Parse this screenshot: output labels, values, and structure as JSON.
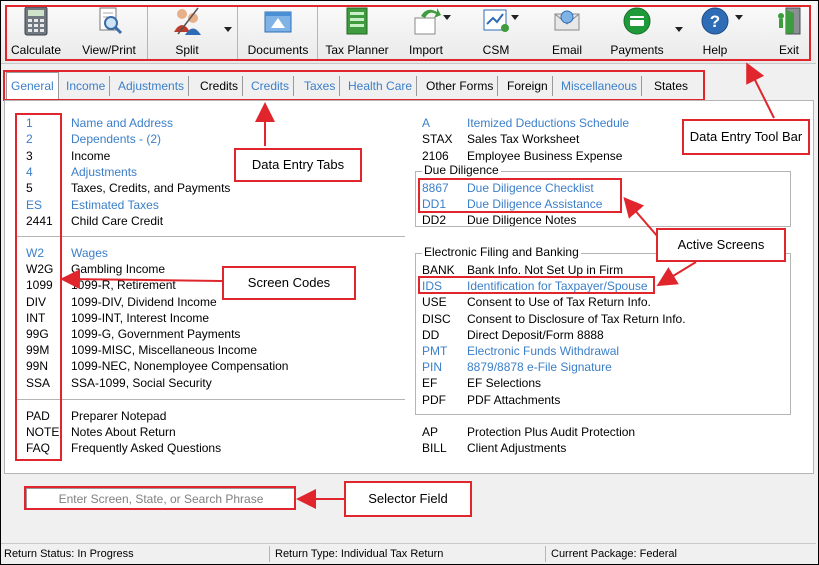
{
  "toolbar": {
    "buttons": [
      {
        "label": "Calculate",
        "icon": "calculator-icon"
      },
      {
        "label": "View/Print",
        "icon": "magnifier-document-icon"
      },
      {
        "label": "Split",
        "icon": "split-people-icon"
      },
      {
        "label": "Documents",
        "icon": "documents-icon"
      },
      {
        "label": "Tax Planner",
        "icon": "tax-planner-icon"
      },
      {
        "label": "Import",
        "icon": "import-icon"
      },
      {
        "label": "CSM",
        "icon": "csm-icon"
      },
      {
        "label": "Email",
        "icon": "email-icon"
      },
      {
        "label": "Payments",
        "icon": "payments-icon"
      },
      {
        "label": "Help",
        "icon": "help-icon"
      },
      {
        "label": "Exit",
        "icon": "exit-door-icon"
      }
    ]
  },
  "tabs": [
    {
      "label": "General",
      "blue": true
    },
    {
      "label": "Income",
      "blue": true
    },
    {
      "label": "Adjustments",
      "blue": true
    },
    {
      "label": "Credits",
      "blue": false
    },
    {
      "label": "Credits",
      "blue": true
    },
    {
      "label": "Taxes",
      "blue": true
    },
    {
      "label": "Health Care",
      "blue": true
    },
    {
      "label": "Other Forms",
      "blue": false
    },
    {
      "label": "Foreign",
      "blue": false
    },
    {
      "label": "Miscellaneous",
      "blue": true
    },
    {
      "label": "States",
      "blue": false
    }
  ],
  "left": {
    "group1": [
      {
        "code": "1",
        "desc": "Name and Address",
        "blue": true
      },
      {
        "code": "2",
        "desc": "Dependents - (2)",
        "blue": true
      },
      {
        "code": "3",
        "desc": "Income",
        "blue": false
      },
      {
        "code": "4",
        "desc": "Adjustments",
        "blue": true
      },
      {
        "code": "5",
        "desc": "Taxes, Credits, and Payments",
        "blue": false
      },
      {
        "code": "ES",
        "desc": "Estimated Taxes",
        "blue": true
      },
      {
        "code": "2441",
        "desc": "Child Care Credit",
        "blue": false
      }
    ],
    "group2": [
      {
        "code": "W2",
        "desc": "Wages",
        "blue": true
      },
      {
        "code": "W2G",
        "desc": "Gambling Income",
        "blue": false
      },
      {
        "code": "1099",
        "desc": "1099-R, Retirement",
        "blue": false
      },
      {
        "code": "DIV",
        "desc": "1099-DIV, Dividend Income",
        "blue": false
      },
      {
        "code": "INT",
        "desc": "1099-INT, Interest Income",
        "blue": false
      },
      {
        "code": "99G",
        "desc": "1099-G, Government Payments",
        "blue": false
      },
      {
        "code": "99M",
        "desc": "1099-MISC, Miscellaneous Income",
        "blue": false
      },
      {
        "code": "99N",
        "desc": "1099-NEC, Nonemployee Compensation",
        "blue": false
      },
      {
        "code": "SSA",
        "desc": "SSA-1099, Social Security",
        "blue": false
      }
    ],
    "group3": [
      {
        "code": "PAD",
        "desc": "Preparer Notepad",
        "blue": false
      },
      {
        "code": "NOTE",
        "desc": "Notes About Return",
        "blue": false
      },
      {
        "code": "FAQ",
        "desc": "Frequently Asked Questions",
        "blue": false
      }
    ]
  },
  "right": {
    "top": [
      {
        "code": "A",
        "desc": "Itemized Deductions Schedule",
        "blue": true
      },
      {
        "code": "STAX",
        "desc": "Sales Tax Worksheet",
        "blue": false
      },
      {
        "code": "2106",
        "desc": "Employee Business Expense",
        "blue": false
      }
    ],
    "due_diligence_title": "Due Diligence",
    "due_diligence": [
      {
        "code": "8867",
        "desc": "Due Diligence Checklist",
        "blue": true
      },
      {
        "code": "DD1",
        "desc": "Due Diligence Assistance",
        "blue": true
      },
      {
        "code": "DD2",
        "desc": "Due Diligence Notes",
        "blue": false
      }
    ],
    "efile_title": "Electronic Filing and Banking",
    "efile": [
      {
        "code": "BANK",
        "desc": "Bank Info. Not Set Up in Firm",
        "blue": false
      },
      {
        "code": "IDS",
        "desc": "Identification for Taxpayer/Spouse",
        "blue": true
      },
      {
        "code": "USE",
        "desc": "Consent to Use of Tax Return Info.",
        "blue": false
      },
      {
        "code": "DISC",
        "desc": "Consent to Disclosure of Tax Return Info.",
        "blue": false
      },
      {
        "code": "DD",
        "desc": "Direct Deposit/Form 8888",
        "blue": false
      },
      {
        "code": "PMT",
        "desc": "Electronic Funds Withdrawal",
        "blue": true
      },
      {
        "code": "PIN",
        "desc": "8879/8878 e-File Signature",
        "blue": true
      },
      {
        "code": "EF",
        "desc": "EF Selections",
        "blue": false
      },
      {
        "code": "PDF",
        "desc": "PDF Attachments",
        "blue": false
      }
    ],
    "bottom": [
      {
        "code": "AP",
        "desc": "Protection Plus Audit Protection",
        "blue": false
      },
      {
        "code": "BILL",
        "desc": "Client Adjustments",
        "blue": false
      }
    ]
  },
  "callouts": {
    "toolbar": "Data Entry Tool Bar",
    "tabs": "Data Entry Tabs",
    "active_screens": "Active Screens",
    "screen_codes": "Screen Codes",
    "selector": "Selector Field"
  },
  "selector": {
    "placeholder": "Enter Screen, State, or Search Phrase"
  },
  "status": {
    "return_status": "Return Status: In Progress",
    "return_type": "Return Type: Individual Tax Return",
    "package": "Current Package: Federal"
  },
  "colors": {
    "blue_link": "#3b7fc9",
    "callout_red": "#e0262c"
  }
}
